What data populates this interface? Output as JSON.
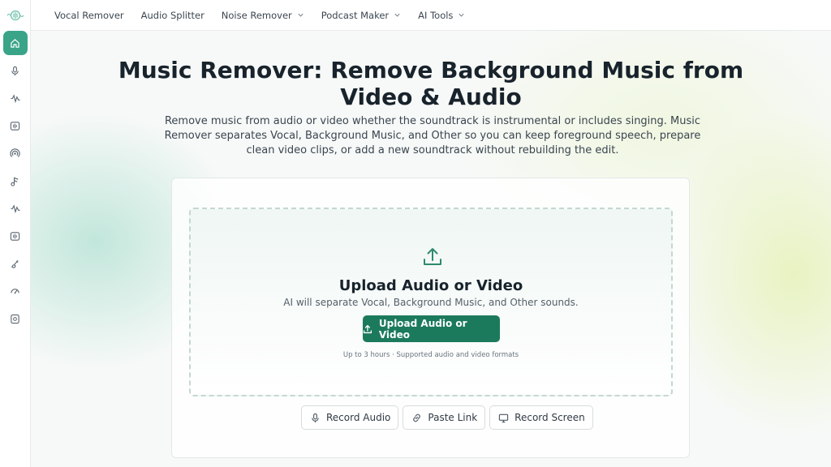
{
  "nav": {
    "items": [
      {
        "label": "Vocal Remover",
        "dropdown": false
      },
      {
        "label": "Audio Splitter",
        "dropdown": false
      },
      {
        "label": "Noise Remover",
        "dropdown": true
      },
      {
        "label": "Podcast Maker",
        "dropdown": true
      },
      {
        "label": "AI Tools",
        "dropdown": true
      }
    ]
  },
  "sidebar": {
    "icons": [
      "home-icon",
      "microphone-icon",
      "waveform-icon",
      "audio-file-icon",
      "podcast-icon",
      "music-note-icon",
      "waveform-alt-icon",
      "audio-file-alt-icon",
      "brush-icon",
      "speed-icon",
      "film-icon"
    ]
  },
  "hero": {
    "title": "Music Remover: Remove Background Music from Video & Audio",
    "subtitle": "Remove music from audio or video whether the soundtrack is instrumental or includes singing. Music Remover separates Vocal, Background Music, and Other so you can keep foreground speech, prepare clean video clips, or add a new soundtrack without rebuilding the edit."
  },
  "upload": {
    "title": "Upload Audio or Video",
    "description": "AI will separate Vocal, Background Music, and Other sounds.",
    "button_label": "Upload Audio or Video",
    "note": "Up to 3 hours · Supported audio and video formats"
  },
  "actions": {
    "record_audio": "Record Audio",
    "paste_link": "Paste Link",
    "record_screen": "Record Screen"
  },
  "colors": {
    "accent": "#1c7a5c",
    "sidebar_active": "#3aa489"
  }
}
